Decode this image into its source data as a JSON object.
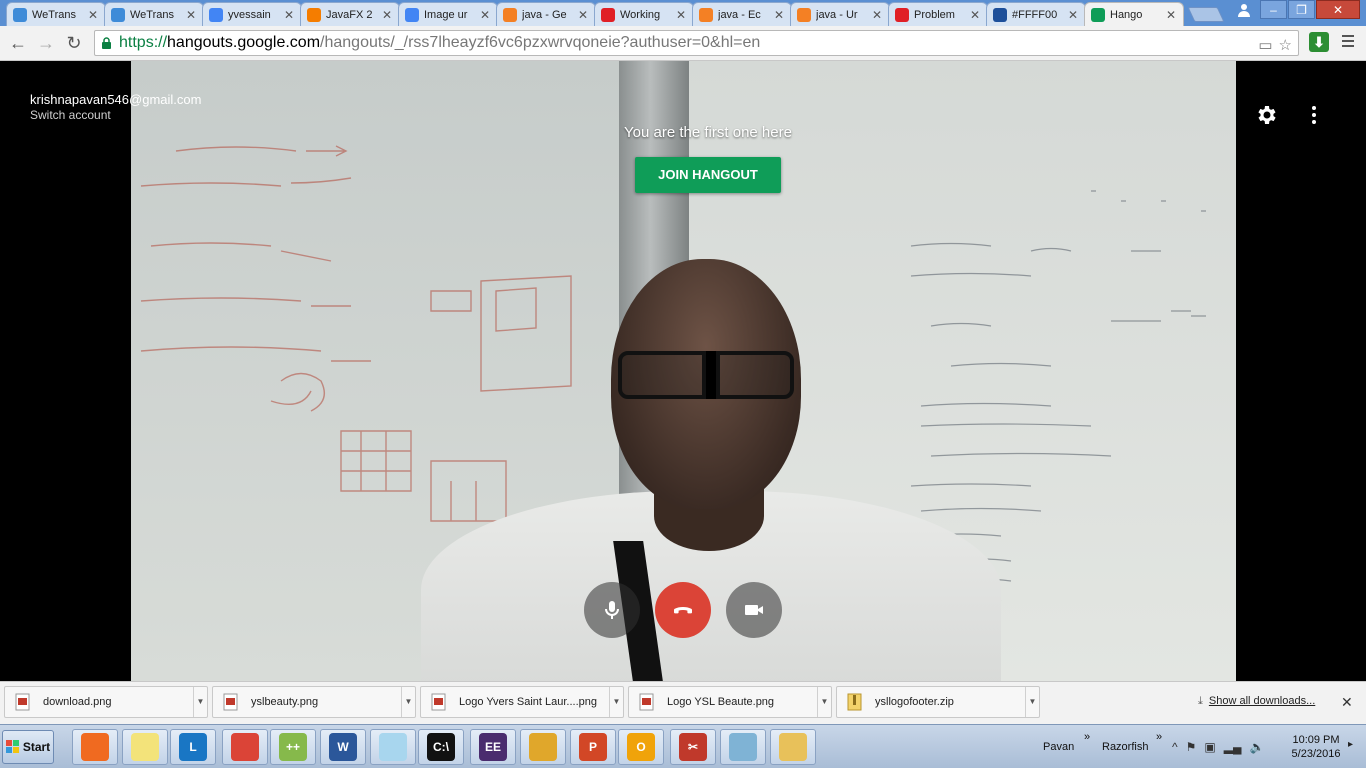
{
  "browser": {
    "tabs": [
      {
        "label": "WeTrans",
        "favicon": "wetransfer-icon",
        "color": "#3e8bd8",
        "active": false
      },
      {
        "label": "WeTrans",
        "favicon": "wetransfer-icon",
        "color": "#3e8bd8",
        "active": false
      },
      {
        "label": "yvessain",
        "favicon": "google-icon",
        "color": "#4285f4",
        "active": false
      },
      {
        "label": "JavaFX 2",
        "favicon": "blogger-icon",
        "color": "#f57d00",
        "active": false
      },
      {
        "label": "Image ur",
        "favicon": "google-icon",
        "color": "#4285f4",
        "active": false
      },
      {
        "label": "java - Ge",
        "favicon": "stackoverflow-icon",
        "color": "#f48024",
        "active": false
      },
      {
        "label": "Working",
        "favicon": "oracle-icon",
        "color": "#e01f25",
        "active": false
      },
      {
        "label": "java - Ec",
        "favicon": "stackoverflow-icon",
        "color": "#f48024",
        "active": false
      },
      {
        "label": "java - Ur",
        "favicon": "stackoverflow-icon",
        "color": "#f48024",
        "active": false
      },
      {
        "label": "Problem",
        "favicon": "oracle-icon",
        "color": "#e01f25",
        "active": false
      },
      {
        "label": "#FFFF00",
        "favicon": "colorhexa-icon",
        "color": "#1d4f9a",
        "active": false
      },
      {
        "label": "Hango",
        "favicon": "hangouts-icon",
        "color": "#0f9d58",
        "active": true
      }
    ],
    "close_glyph": "✕",
    "url": {
      "scheme": "https://",
      "host": "hangouts.google.com",
      "path": "/hangouts/_/rss7lheayzf6vc6pzxwrvqoneie?authuser=0&hl=en"
    }
  },
  "hangout": {
    "account_email": "krishnapavan546@gmail.com",
    "switch_account": "Switch account",
    "status_message": "You are the first one here",
    "join_button": "JOIN HANGOUT",
    "accent_color": "#0f9d58",
    "end_call_color": "#db4437"
  },
  "downloads": {
    "items": [
      {
        "label": "download.png",
        "type": "png"
      },
      {
        "label": "yslbeauty.png",
        "type": "png"
      },
      {
        "label": "Logo Yvers Saint Laur....png",
        "type": "png"
      },
      {
        "label": "Logo YSL Beaute.png",
        "type": "png"
      },
      {
        "label": "ysllogofooter.zip",
        "type": "zip"
      }
    ],
    "show_all": "Show all downloads..."
  },
  "taskbar": {
    "start_label": "Start",
    "toolbar_pavan": "Pavan",
    "toolbar_razorfish": "Razorfish",
    "time": "10:09 PM",
    "date": "5/23/2016",
    "apps": [
      {
        "name": "satellite-dish-icon",
        "color": "#f06a20",
        "text": ""
      },
      {
        "name": "sticky-notes-icon",
        "color": "#f3e37a",
        "text": ""
      },
      {
        "name": "lync-icon",
        "color": "#1976c4",
        "text": "L"
      },
      {
        "name": "chrome-icon",
        "color": "#db4437",
        "text": ""
      },
      {
        "name": "notepad-plus-icon",
        "color": "#86b94b",
        "text": "++"
      },
      {
        "name": "word-icon",
        "color": "#2b579a",
        "text": "W"
      },
      {
        "name": "notepad-icon",
        "color": "#a8d6ee",
        "text": ""
      },
      {
        "name": "command-prompt-icon",
        "color": "#111111",
        "text": "C:\\"
      },
      {
        "name": "java-ee-ide-icon",
        "color": "#4a2c6e",
        "text": "EE"
      },
      {
        "name": "stack-icon",
        "color": "#e0a72b",
        "text": ""
      },
      {
        "name": "powerpoint-icon",
        "color": "#d24726",
        "text": "P"
      },
      {
        "name": "outlook-icon",
        "color": "#f0a30a",
        "text": "O"
      },
      {
        "name": "snipping-tool-icon",
        "color": "#c0392b",
        "text": "✂"
      },
      {
        "name": "paint-icon",
        "color": "#7fb3d5",
        "text": ""
      },
      {
        "name": "file-explorer-icon",
        "color": "#e8c15a",
        "text": ""
      }
    ]
  }
}
